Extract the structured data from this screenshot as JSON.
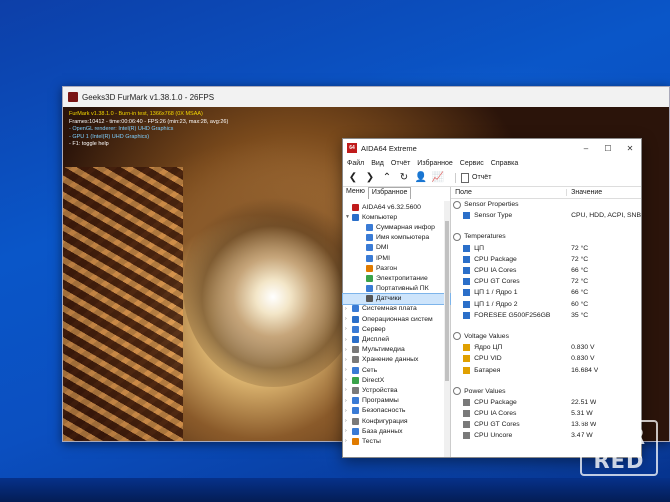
{
  "furmark": {
    "title": "Geeks3D FurMark v1.38.1.0 - 26FPS",
    "hud": [
      "FurMark v1.38.1.0 - Burn-in test, 1366x768 (0X MSAA)",
      "Frames:10412 - time:00:06:40 - FPS:26 (min:23, max:28, avg:26)",
      "- OpenGL renderer: Intel(R) UHD Graphics",
      "- GPU 1 (Intel(R) UHD Graphics)",
      "- F1: toggle help"
    ]
  },
  "aida": {
    "title": "AIDA64 Extreme",
    "window_buttons": [
      "–",
      "☐",
      "✕"
    ],
    "menu": [
      "Файл",
      "Вид",
      "Отчёт",
      "Избранное",
      "Сервис",
      "Справка"
    ],
    "toolbar": {
      "back": "❮",
      "forward": "❯",
      "up": "⌃",
      "refresh": "↻",
      "user": "👤",
      "chart": "📈",
      "report_label": "Отчёт"
    },
    "left_tabs": [
      "Меню",
      "Избранное"
    ],
    "tree": [
      {
        "label": "AIDA64 v6.32.5600",
        "indent": 0,
        "arrow": "",
        "icon": "#c01b1b"
      },
      {
        "label": "Компьютер",
        "indent": 0,
        "arrow": "▼",
        "icon": "#2b6fc9"
      },
      {
        "label": "Суммарная инфор",
        "indent": 1,
        "arrow": "",
        "icon": "#3a7bd5"
      },
      {
        "label": "Имя компьютера",
        "indent": 1,
        "arrow": "",
        "icon": "#3a7bd5"
      },
      {
        "label": "DMI",
        "indent": 1,
        "arrow": "",
        "icon": "#3a7bd5"
      },
      {
        "label": "IPMI",
        "indent": 1,
        "arrow": "",
        "icon": "#3a7bd5"
      },
      {
        "label": "Разгон",
        "indent": 1,
        "arrow": "",
        "icon": "#e07b00"
      },
      {
        "label": "Электропитание",
        "indent": 1,
        "arrow": "",
        "icon": "#3aa34a"
      },
      {
        "label": "Портативный ПК",
        "indent": 1,
        "arrow": "",
        "icon": "#3a7bd5"
      },
      {
        "label": "Датчики",
        "indent": 1,
        "arrow": "",
        "icon": "#555555",
        "selected": true
      },
      {
        "label": "Системная плата",
        "indent": 0,
        "arrow": "›",
        "icon": "#3a7bd5"
      },
      {
        "label": "Операционная систем",
        "indent": 0,
        "arrow": "›",
        "icon": "#2b6fc9"
      },
      {
        "label": "Сервер",
        "indent": 0,
        "arrow": "›",
        "icon": "#3a7bd5"
      },
      {
        "label": "Дисплей",
        "indent": 0,
        "arrow": "›",
        "icon": "#2b6fc9"
      },
      {
        "label": "Мультимедиа",
        "indent": 0,
        "arrow": "›",
        "icon": "#7a7a7a"
      },
      {
        "label": "Хранение данных",
        "indent": 0,
        "arrow": "›",
        "icon": "#7a7a7a"
      },
      {
        "label": "Сеть",
        "indent": 0,
        "arrow": "›",
        "icon": "#3a7bd5"
      },
      {
        "label": "DirectX",
        "indent": 0,
        "arrow": "›",
        "icon": "#3aa34a"
      },
      {
        "label": "Устройства",
        "indent": 0,
        "arrow": "›",
        "icon": "#7a7a7a"
      },
      {
        "label": "Программы",
        "indent": 0,
        "arrow": "›",
        "icon": "#3a7bd5"
      },
      {
        "label": "Безопасность",
        "indent": 0,
        "arrow": "›",
        "icon": "#3a7bd5"
      },
      {
        "label": "Конфигурация",
        "indent": 0,
        "arrow": "›",
        "icon": "#7a7a7a"
      },
      {
        "label": "База данных",
        "indent": 0,
        "arrow": "›",
        "icon": "#3a7bd5"
      },
      {
        "label": "Тесты",
        "indent": 0,
        "arrow": "›",
        "icon": "#e07b00"
      }
    ],
    "columns": {
      "field": "Поле",
      "value": "Значение"
    },
    "sections": [
      {
        "title": "Sensor Properties",
        "rows": [
          {
            "name": "Sensor Type",
            "value": "CPU, HDD, ACPI, SNB"
          }
        ]
      },
      {
        "title": "Temperatures",
        "rows": [
          {
            "name": "ЦП",
            "value": "72 °C"
          },
          {
            "name": "CPU Package",
            "value": "72 °C"
          },
          {
            "name": "CPU IA Cores",
            "value": "66 °C"
          },
          {
            "name": "CPU GT Cores",
            "value": "72 °C"
          },
          {
            "name": "ЦП 1 / Ядро 1",
            "value": "66 °C"
          },
          {
            "name": "ЦП 1 / Ядро 2",
            "value": "60 °C"
          },
          {
            "name": "FORESEE G500F256GB",
            "value": "35 °C"
          }
        ]
      },
      {
        "title": "Voltage Values",
        "rows": [
          {
            "name": "Ядро ЦП",
            "value": "0.830 V"
          },
          {
            "name": "CPU VID",
            "value": "0.830 V"
          },
          {
            "name": "Батарея",
            "value": "16.684 V"
          }
        ]
      },
      {
        "title": "Power Values",
        "rows": [
          {
            "name": "CPU Package",
            "value": "22.51 W"
          },
          {
            "name": "CPU IA Cores",
            "value": "5.31 W"
          },
          {
            "name": "CPU GT Cores",
            "value": "13.68 W"
          },
          {
            "name": "CPU Uncore",
            "value": "3.47 W"
          }
        ]
      }
    ]
  },
  "watermark": {
    "line1": "DNR",
    "line2": "RED"
  }
}
